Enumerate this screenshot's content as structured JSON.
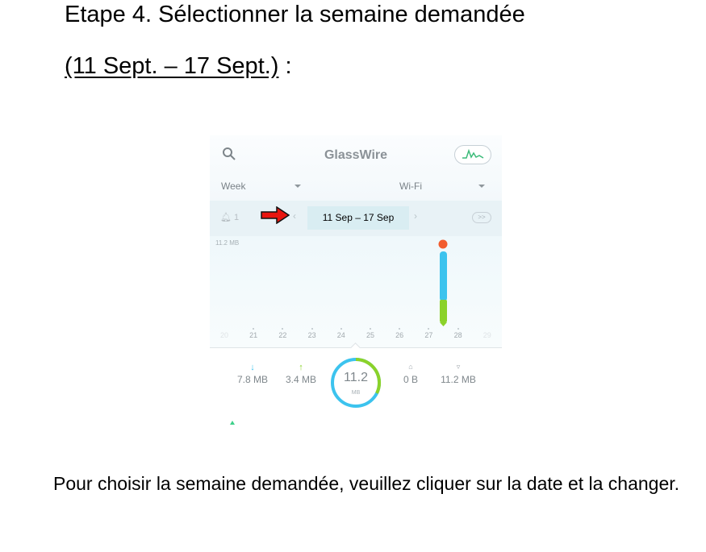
{
  "heading": {
    "line1": "Etape 4. Sélectionner la semaine demandée",
    "line2_underlined": "(11 Sept. – 17 Sept.)",
    "line2_suffix": " :"
  },
  "screenshot": {
    "app_title": "GlassWire",
    "period_dropdown": "Week",
    "network_dropdown": "Wi-Fi",
    "alerts_count": "1",
    "date_range": "11 Sep – 17 Sep",
    "forward_button": ">>",
    "chart_data": {
      "type": "bar",
      "y_max_label": "11.2 MB",
      "categories": [
        "20",
        "21",
        "22",
        "23",
        "24",
        "25",
        "26",
        "27",
        "28",
        "29"
      ],
      "values_mb": [
        0,
        0,
        0,
        0,
        0,
        0,
        0,
        0,
        11.2,
        0
      ],
      "highlighted_category": "28",
      "colors": {
        "upload": "#8bd22a",
        "download": "#3cc3ee",
        "alert": "#f25c2e"
      }
    },
    "stats": {
      "download": {
        "icon": "arrow-down-icon",
        "value": "7.8 MB"
      },
      "upload": {
        "icon": "arrow-up-icon",
        "value": "3.4 MB"
      },
      "total": {
        "value": "11.2",
        "unit": "MB"
      },
      "mobile": {
        "icon": "mobile-data-icon",
        "value": "0 B"
      },
      "wifi": {
        "icon": "wifi-icon",
        "value": "11.2 MB"
      }
    }
  },
  "instruction": "Pour choisir la semaine demandée, veuillez cliquer sur la date et la changer."
}
